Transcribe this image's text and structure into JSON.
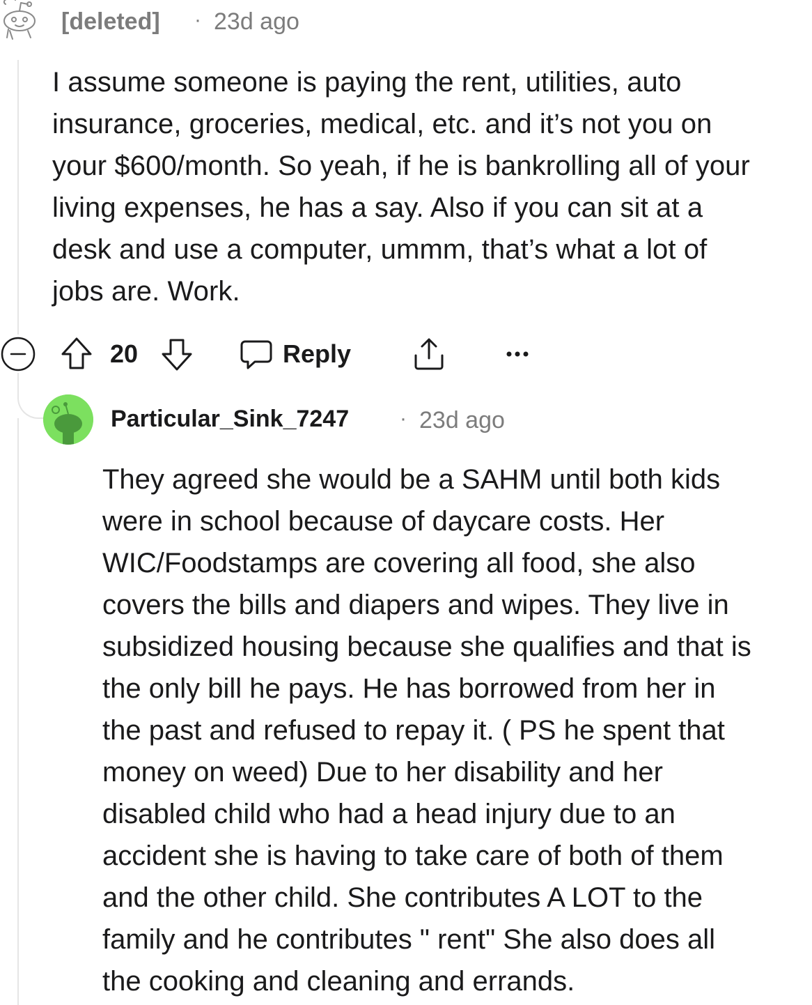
{
  "parent_comment": {
    "author": "[deleted]",
    "separator": "·",
    "time": "23d ago",
    "body_lines": [
      "I assume someone is paying the rent, utilities, auto",
      "insurance, groceries, medical, etc. and it’s not you on",
      "your $600/month. So yeah, if he is bankrolling all of your",
      "living expenses, he has a say. Also if you can sit at a",
      "desk and use a computer, ummm, that’s what a lot of",
      "jobs are. Work."
    ],
    "actions": {
      "collapse_icon": "collapse-minus-icon",
      "upvote_icon": "upvote-arrow-icon",
      "vote_count": "20",
      "downvote_icon": "downvote-arrow-icon",
      "reply_icon": "speech-bubble-icon",
      "reply_label": "Reply",
      "share_icon": "share-upload-icon",
      "more_icon": "more-dots-icon"
    }
  },
  "reply_comment": {
    "author": "Particular_Sink_7247",
    "separator": "·",
    "time": "23d ago",
    "avatar_color": "#7ce05f",
    "body_lines": [
      "They agreed she would be a SAHM until both kids",
      "were in school because of daycare costs. Her",
      "WIC/Foodstamps are covering all food, she also",
      "covers the bills and diapers and wipes. They live in",
      "subsidized housing because she qualifies and that is",
      "the only bill he pays. He has borrowed from her in",
      "the past and refused to repay it. ( PS he spent that",
      "money on weed) Due to her disability and her",
      "disabled child who had a head injury due to an",
      "accident she is having to take care of both of them",
      "and the other child. She contributes A LOT to the",
      "family and he contributes \" rent\" She also does all",
      "the cooking and cleaning and errands."
    ]
  },
  "colors": {
    "text": "#1a1a1b",
    "meta": "#7c7c7c",
    "thread_line": "#e5e5e5"
  }
}
